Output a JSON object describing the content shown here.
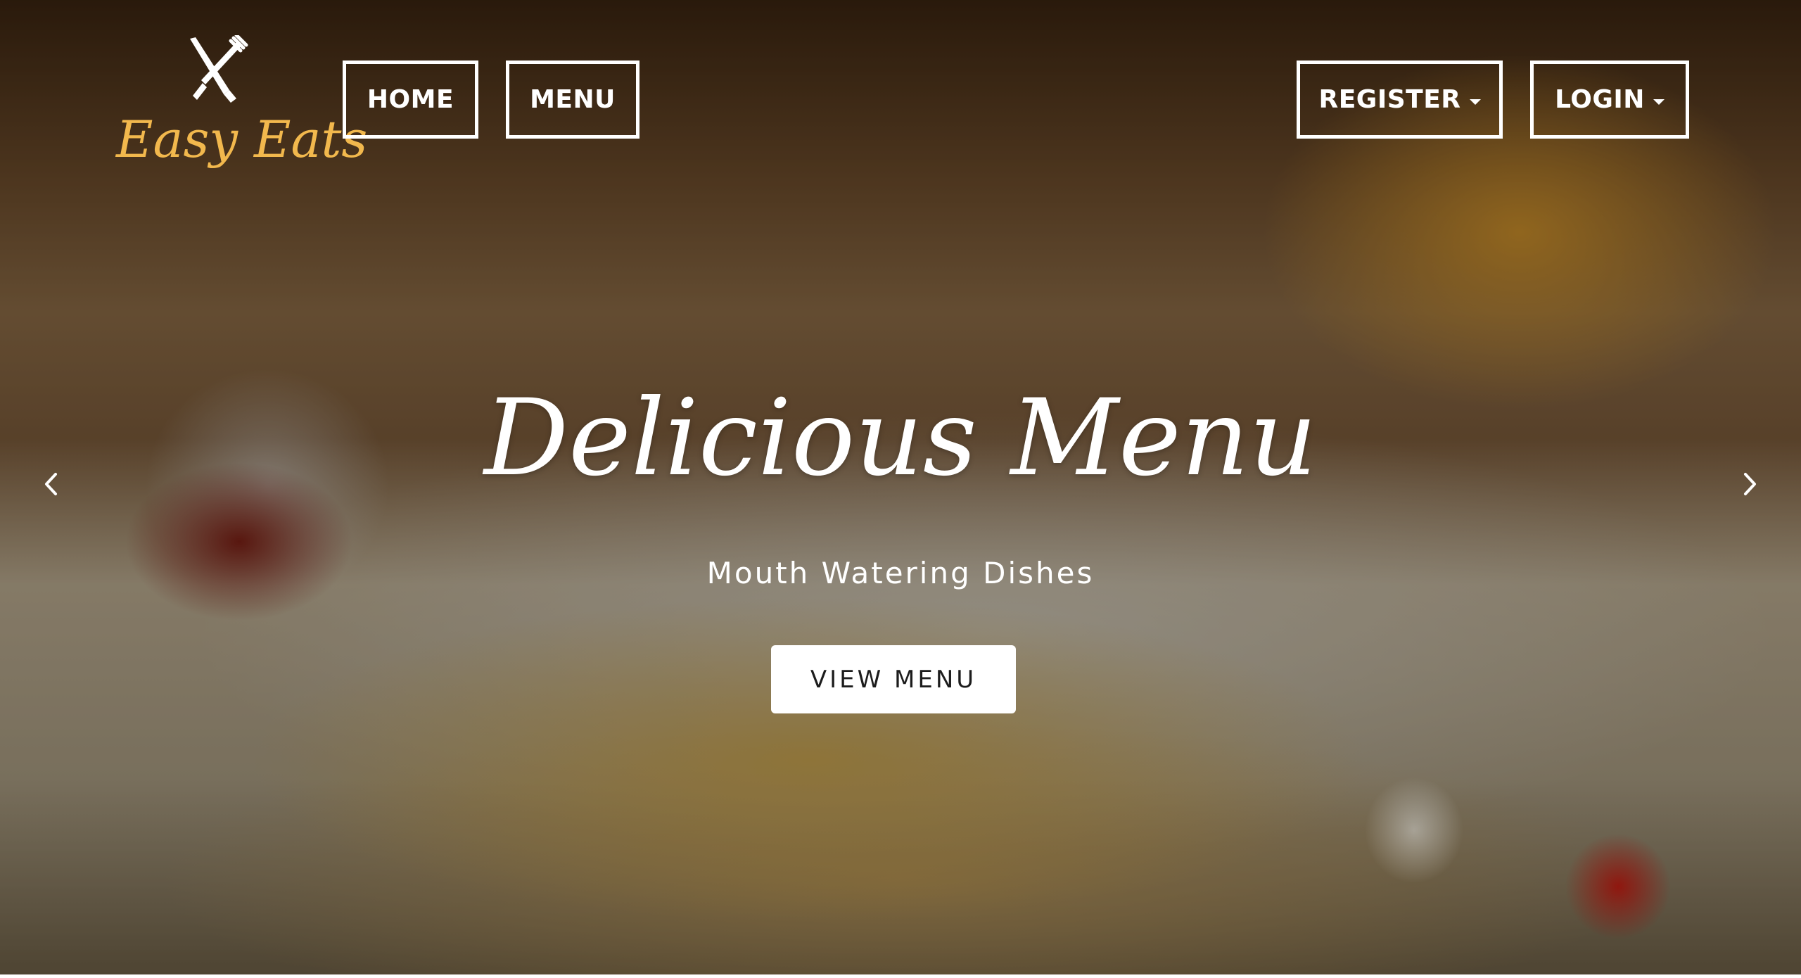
{
  "brand": {
    "name": "Easy Eats",
    "logo_icon": "fork-knife-icon",
    "text_color": "#f2b84d"
  },
  "nav": {
    "home_label": "HOME",
    "menu_label": "MENU",
    "register_label": "REGISTER",
    "login_label": "LOGIN"
  },
  "hero": {
    "title": "Delicious Menu",
    "subtitle": "Mouth Watering Dishes",
    "cta_label": "VIEW MENU",
    "prev_icon": "chevron-left-icon",
    "next_icon": "chevron-right-icon"
  },
  "colors": {
    "nav_border": "#ffffff",
    "cta_background": "#ffffff",
    "cta_text": "#1c1c1c"
  }
}
